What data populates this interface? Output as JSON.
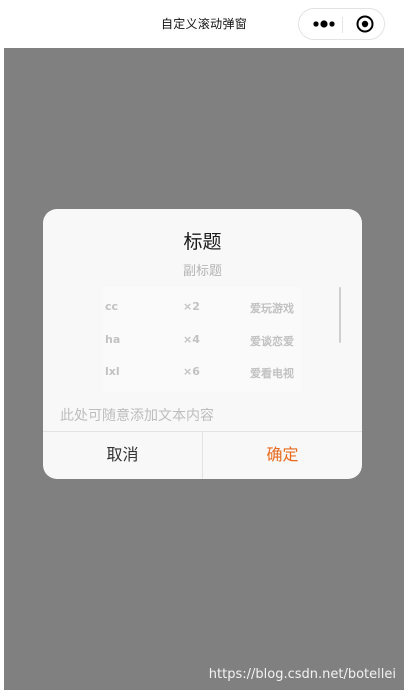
{
  "navbar": {
    "title": "自定义滚动弹窗",
    "capsule_icons": [
      "more-icon",
      "close-icon"
    ]
  },
  "dialog": {
    "title": "标题",
    "subtitle": "副标题",
    "rows": [
      {
        "name": "cc",
        "count": "×2",
        "hobby": "爱玩游戏"
      },
      {
        "name": "ha",
        "count": "×4",
        "hobby": "爱谈恋爱"
      },
      {
        "name": "lxl",
        "count": "×6",
        "hobby": "爱看电视"
      }
    ],
    "content": "此处可随意添加文本内容",
    "cancel_label": "取消",
    "confirm_label": "确定"
  },
  "colors": {
    "overlay": "#808080",
    "confirm_accent": "#e86a1f",
    "dialog_bg": "#f8f8f8"
  },
  "watermark": "https://blog.csdn.net/botellei"
}
